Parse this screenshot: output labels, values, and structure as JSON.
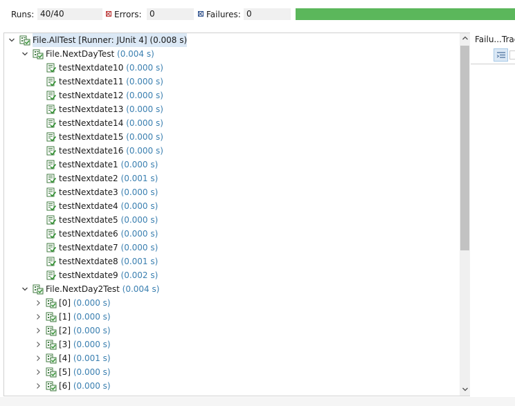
{
  "stats": {
    "runs_label": "Runs:",
    "runs_value": "40/40",
    "errors_label": "Errors:",
    "errors_value": "0",
    "failures_label": "Failures:",
    "failures_value": "0",
    "progress_fraction": 1.0,
    "progress_color": "#5bb75b"
  },
  "tree": {
    "root": {
      "name": "File.AllTest [Runner: JUnit 4] (0.008 s)",
      "time": ""
    },
    "suites": [
      {
        "name": "File.NextDayTest",
        "time": "(0.004 s)",
        "tests": [
          {
            "name": "testNextdate10",
            "time": "(0.000 s)"
          },
          {
            "name": "testNextdate11",
            "time": "(0.000 s)"
          },
          {
            "name": "testNextdate12",
            "time": "(0.000 s)"
          },
          {
            "name": "testNextdate13",
            "time": "(0.000 s)"
          },
          {
            "name": "testNextdate14",
            "time": "(0.000 s)"
          },
          {
            "name": "testNextdate15",
            "time": "(0.000 s)"
          },
          {
            "name": "testNextdate16",
            "time": "(0.000 s)"
          },
          {
            "name": "testNextdate1",
            "time": "(0.000 s)"
          },
          {
            "name": "testNextdate2",
            "time": "(0.001 s)"
          },
          {
            "name": "testNextdate3",
            "time": "(0.000 s)"
          },
          {
            "name": "testNextdate4",
            "time": "(0.000 s)"
          },
          {
            "name": "testNextdate5",
            "time": "(0.000 s)"
          },
          {
            "name": "testNextdate6",
            "time": "(0.000 s)"
          },
          {
            "name": "testNextdate7",
            "time": "(0.000 s)"
          },
          {
            "name": "testNextdate8",
            "time": "(0.001 s)"
          },
          {
            "name": "testNextdate9",
            "time": "(0.002 s)"
          }
        ]
      },
      {
        "name": "File.NextDay2Test",
        "time": "(0.004 s)",
        "tests": [
          {
            "name": "[0]",
            "time": "(0.000 s)"
          },
          {
            "name": "[1]",
            "time": "(0.000 s)"
          },
          {
            "name": "[2]",
            "time": "(0.000 s)"
          },
          {
            "name": "[3]",
            "time": "(0.000 s)"
          },
          {
            "name": "[4]",
            "time": "(0.001 s)"
          },
          {
            "name": "[5]",
            "time": "(0.000 s)"
          },
          {
            "name": "[6]",
            "time": "(0.000 s)"
          }
        ]
      }
    ]
  },
  "trace_panel": {
    "title": "Failu...Trac"
  },
  "icons": {
    "expanded": "chevron-down-icon",
    "collapsed": "chevron-right-icon",
    "suite": "junit-suite-pass-icon",
    "test": "junit-test-pass-icon",
    "filter": "filter-stack-trace-icon"
  }
}
